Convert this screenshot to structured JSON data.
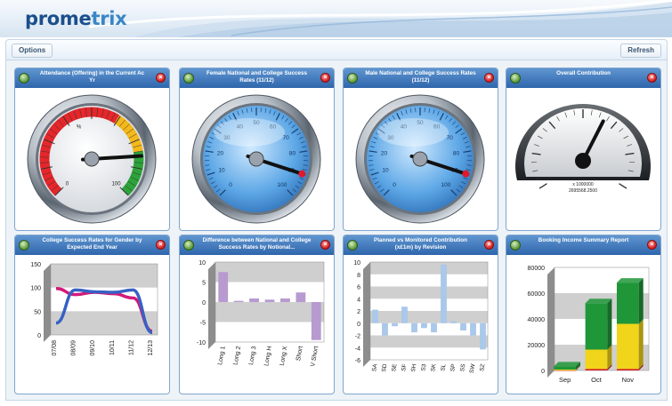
{
  "app": {
    "logo_part1": "prome",
    "logo_part2": "trix"
  },
  "toolbar": {
    "options_label": "Options",
    "refresh_label": "Refresh"
  },
  "widgets": [
    {
      "title": "Attendance (Offering) in the Current Ac Yr",
      "gauge_labels": [
        "0",
        "%",
        "100"
      ],
      "needle_value": 0.82
    },
    {
      "title": "Female National and College Success Rates (11/12)",
      "gauge_labels": [
        "0",
        "10",
        "20",
        "30",
        "40",
        "50",
        "60",
        "70",
        "80",
        "90",
        "100"
      ],
      "needle_value": 0.9
    },
    {
      "title": "Male National and College Success Rates (11/12)",
      "gauge_labels": [
        "0",
        "10",
        "20",
        "30",
        "40",
        "50",
        "60",
        "70",
        "80",
        "90",
        "100"
      ],
      "needle_value": 0.9
    },
    {
      "title": "Overall Contribution",
      "scale_text": "x 1000000",
      "value_text": "2695568.2500"
    },
    {
      "title": "College Success Rates for Gender by Expected End Year"
    },
    {
      "title": "Difference between National and College Success Rates by Notional..."
    },
    {
      "title": "Planned vs Monitored Contribution (x£1m) by Revision"
    },
    {
      "title": "Booking Income Summary Report"
    }
  ],
  "chart_data": [
    {
      "type": "line",
      "title": "College Success Rates for Gender by Expected End Year",
      "categories": [
        "07/08",
        "08/09",
        "09/10",
        "10/11",
        "11/12",
        "12/13"
      ],
      "series": [
        {
          "values": [
            98,
            85,
            90,
            87,
            78,
            8
          ],
          "color": "#d4197a"
        },
        {
          "values": [
            25,
            95,
            91,
            90,
            95,
            5
          ],
          "color": "#3761c4"
        }
      ],
      "ylim": [
        0,
        150
      ],
      "yticks": [
        "0",
        "50",
        "100",
        "150"
      ]
    },
    {
      "type": "bar",
      "title": "Difference between National and College Success Rates by Notional...",
      "categories": [
        "Long 1",
        "Long 2",
        "Long 3",
        "Long H",
        "Long X",
        "Short",
        "V Short"
      ],
      "values": [
        7.5,
        0.3,
        0.9,
        0.6,
        0.9,
        2.4,
        -9.5
      ],
      "color": "#b79ad0",
      "ylim": [
        -10,
        10
      ],
      "yticks": [
        "-10",
        "-5",
        "0",
        "5",
        "10"
      ]
    },
    {
      "type": "bar",
      "title": "Planned vs Monitored Contribution (x£1m) by Revision",
      "categories": [
        "SA",
        "SD",
        "SE",
        "SF",
        "SH",
        "S3",
        "SK",
        "SL",
        "SP",
        "SS",
        "SW",
        "SZ"
      ],
      "values": [
        2.2,
        -2,
        -0.5,
        2.7,
        -1.5,
        -0.8,
        -1.5,
        9.6,
        0.3,
        -1.2,
        -2.0,
        -4.3
      ],
      "color": "#a9c8ea",
      "ylim": [
        -6,
        10
      ],
      "yticks": [
        "-6",
        "-4",
        "-2",
        "0",
        "2",
        "4",
        "6",
        "8",
        "10"
      ]
    },
    {
      "type": "bar",
      "title": "Booking Income Summary Report",
      "categories": [
        "Sep",
        "Oct",
        "Nov"
      ],
      "series": [
        {
          "values": [
            400,
            1200,
            1200
          ],
          "color": "#d62020"
        },
        {
          "values": [
            300,
            15000,
            35000
          ],
          "color": "#f0d51b"
        },
        {
          "values": [
            2500,
            36000,
            32000
          ],
          "color": "#1f9638"
        }
      ],
      "ylim": [
        0,
        80000
      ],
      "yticks": [
        "0",
        "20000",
        "40000",
        "60000",
        "80000"
      ]
    }
  ]
}
